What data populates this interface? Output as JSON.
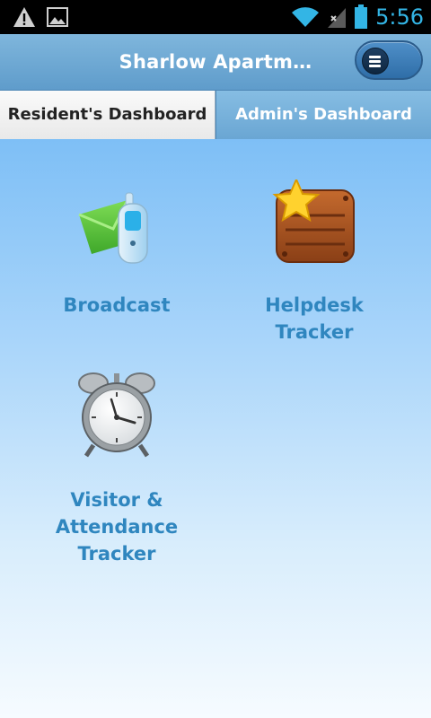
{
  "status_bar": {
    "time": "5:56",
    "icons": [
      "warning-icon",
      "image-icon",
      "wifi-icon",
      "signal-icon",
      "battery-icon"
    ]
  },
  "action_bar": {
    "title": "Sharlow Apartm…",
    "menu_icon": "menu-icon"
  },
  "tabs": [
    {
      "label": "Resident's Dashboard",
      "selected": true
    },
    {
      "label": "Admin's Dashboard",
      "selected": false
    }
  ],
  "tiles": [
    {
      "label": "Broadcast",
      "icon": "broadcast-icon"
    },
    {
      "label": "Helpdesk\nTracker",
      "icon": "helpdesk-icon"
    },
    {
      "label": "Visitor &\nAttendance\nTracker",
      "icon": "alarm-clock-icon"
    }
  ],
  "colors": {
    "status_accent": "#33b5e5",
    "action_bar": "#5f9ccb",
    "tile_label": "#2f86bf"
  }
}
